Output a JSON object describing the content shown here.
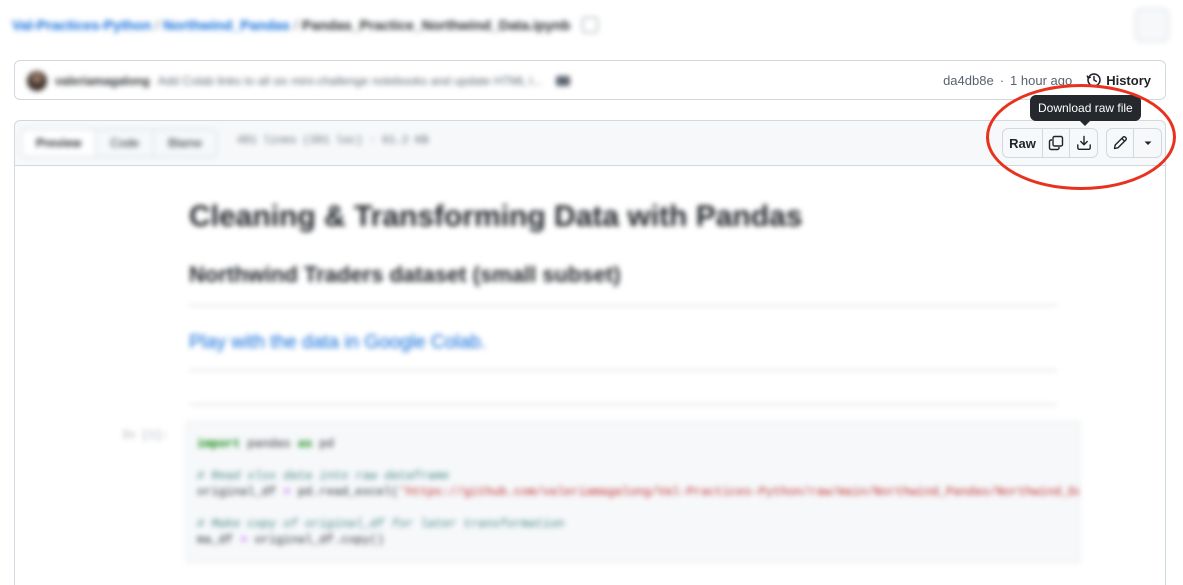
{
  "breadcrumb": {
    "repo": "Val-Practices-Python",
    "folder": "Northwind_Pandas",
    "file": "Pandas_Practice_Northwind_Data.ipynb",
    "sep": "/"
  },
  "commit": {
    "author": "valeriamagalong",
    "message": "Add Colab links to all six mini-challenge notebooks and update HTML l...",
    "hash": "da4db8e",
    "dot": "·",
    "time": "1 hour ago",
    "history_label": "History"
  },
  "file_header": {
    "tabs": [
      "Preview",
      "Code",
      "Blame"
    ],
    "active_tab": "Preview",
    "meta": "481 lines (391 loc) · 61.2 KB"
  },
  "actions": {
    "raw_label": "Raw",
    "copy_icon": "copy-icon",
    "download_icon": "download-icon",
    "edit_icon": "pencil-icon",
    "dropdown_icon": "triangle-down-icon"
  },
  "tooltip": {
    "text": "Download raw file"
  },
  "annotation": {
    "color": "#e8321f"
  },
  "notebook": {
    "title": "Cleaning & Transforming Data with Pandas",
    "subtitle": "Northwind Traders dataset (small subset)",
    "link": "Play with the data in Google Colab.",
    "prompt": "In [1]:",
    "code": {
      "line1_kw": "import",
      "line1_rest": " pandas ",
      "line1_kw2": "as",
      "line1_end": " pd",
      "comment1": "# Read xlsx data into raw dataframe",
      "line2_lhs": "original_df ",
      "line2_op": "=",
      "line2_call": " pd.read_excel(",
      "line2_str": "'https://github.com/valeriamagalong/Val-Practices-Python/raw/main/Northwind_Pandas/Northwind_Data.xlsx'",
      "comment2": "# Make copy of original_df for later transformation",
      "line3_lhs": "ma_df ",
      "line3_op": "=",
      "line3_rest": " original_df.copy()"
    }
  }
}
